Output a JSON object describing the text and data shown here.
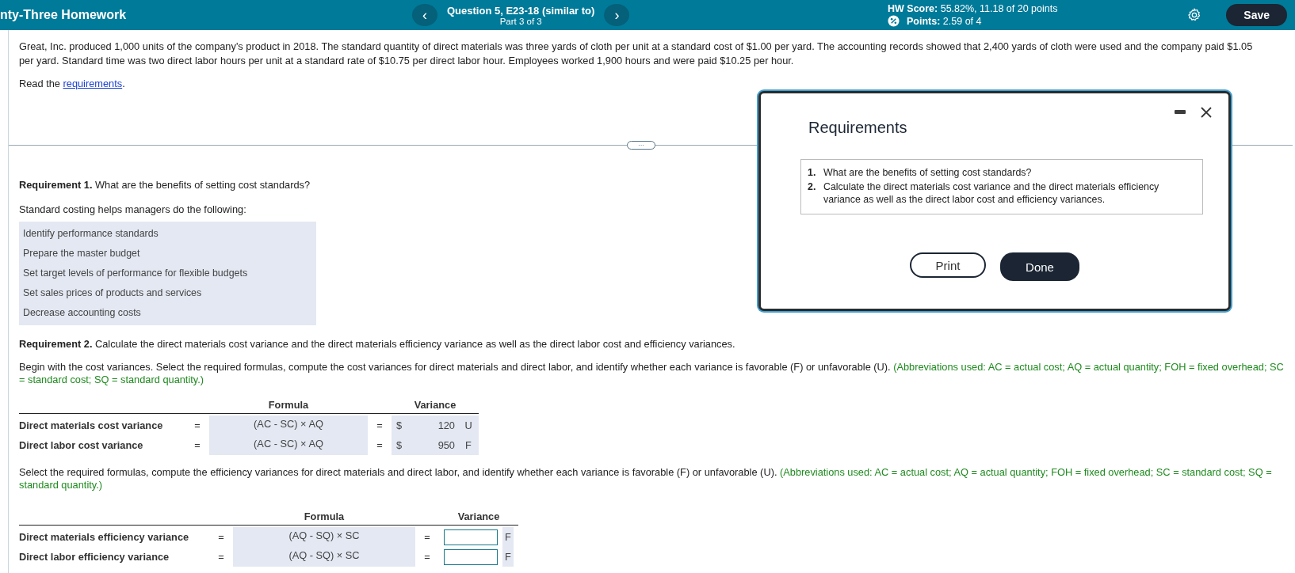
{
  "header": {
    "assignment_title": "nty-Three Homework",
    "prev_button": "‹",
    "question_title": "Question 5, E23-18 (similar to)",
    "part": "Part 3 of 3",
    "next_button": "›",
    "hw_score": "**HW Score:** 55.82%, 11.18 of 20 points",
    "points": "**Points:** 2.59 of 4",
    "save_button": "Save"
  },
  "problem": {
    "text": "Great, Inc. produced 1,000 units of the company's product in 2018. The standard quantity of direct materials was three yards of cloth per unit at a standard cost of $1.00 per yard. The accounting records showed that 2,400 yards of cloth were used and the company paid $1.05 per yard. Standard time was two direct labor hours per unit at a standard rate of $10.75 per direct labor hour. Employees worked 1,900 hours and were paid $10.25 per hour.",
    "read_prefix": "Read the",
    "read_link": "requirements",
    "read_suffix": ".",
    "expand_button": "···"
  },
  "requirement1": {
    "question": "**Requirement 1.** What are the benefits of setting cost standards?",
    "lead": "Standard costing helps managers do the following:",
    "answers": [
      "Identify performance standards",
      "Prepare the master budget",
      "Set target levels of performance for flexible budgets",
      "Set sales prices of products and services",
      "Decrease accounting costs"
    ]
  },
  "requirement2": {
    "question": "**Requirement 2.** Calculate the direct materials cost variance and the direct materials efficiency variance as well as the direct labor cost and efficiency variances.",
    "cost_instructions": "Begin with the cost variances. Select the required formulas, compute the cost variances for direct materials and direct labor, and identify whether each variance is favorable (F) or unfavorable (U).",
    "cost_note": "(Abbreviations used: AC = actual cost; AQ = actual quantity; FOH = fixed overhead; SC = standard cost; SQ = standard quantity.)",
    "cost_table": {
      "columns": [
        "Formula",
        "Variance"
      ],
      "rows": [
        {
          "label": "Direct materials cost variance",
          "eq1": "=",
          "formula": "(AC - SC) × AQ",
          "eq2": "=",
          "currency": "$",
          "value": "120",
          "result": "U"
        },
        {
          "label": "Direct labor cost variance",
          "eq1": "=",
          "formula": "(AC - SC) × AQ",
          "eq2": "=",
          "currency": "$",
          "value": "950",
          "result": "F"
        }
      ]
    },
    "efficiency_instructions": "Select the required formulas, compute the efficiency variances for direct materials and direct labor, and identify whether each variance is favorable (F) or unfavorable (U).",
    "efficiency_note": "(Abbreviations used: AC = actual cost; AQ = actual quantity; FOH = fixed overhead; SC = standard cost; SQ = standard quantity.)",
    "efficiency_table": {
      "columns": [
        "Formula",
        "Variance"
      ],
      "rows": [
        {
          "label": "Direct materials efficiency variance",
          "eq1": "=",
          "formula": "(AQ - SQ) × SC",
          "eq2": "=",
          "result": "F"
        },
        {
          "label": "Direct labor efficiency variance",
          "eq1": "=",
          "formula": "(AQ - SQ) × SC",
          "eq2": "=",
          "result": "F"
        }
      ]
    }
  },
  "dialog": {
    "title": "Requirements",
    "items": [
      {
        "number": "1.",
        "text": "What are the benefits of setting cost standards?"
      },
      {
        "number": "2.",
        "text": "Calculate the direct materials cost variance and the direct materials efficiency variance as well as the direct labor cost and efficiency variances."
      }
    ],
    "buttons": [
      {
        "label": "Print",
        "kind": "secondary"
      },
      {
        "label": "Done",
        "kind": "primary"
      }
    ]
  }
}
